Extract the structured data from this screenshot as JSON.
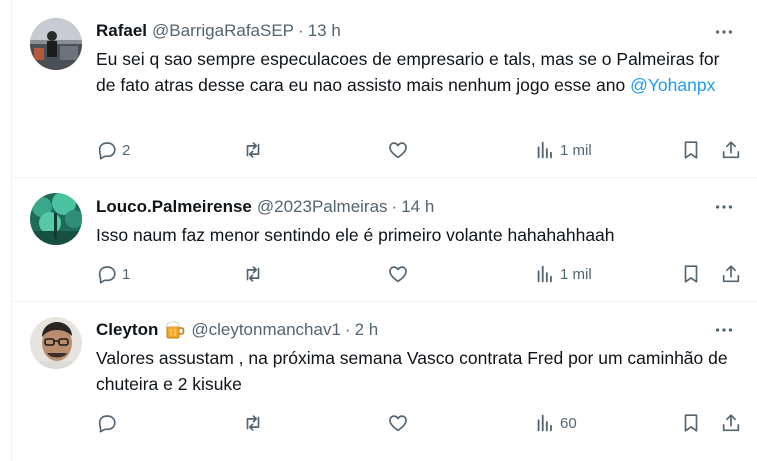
{
  "colors": {
    "accent": "#1d9bf0",
    "secondary_text": "#536471",
    "primary_text": "#0f1419",
    "divider": "#eff3f4"
  },
  "tweets": [
    {
      "name": "Rafael",
      "handle": "@BarrigaRafaSEP",
      "separator": "·",
      "time": "13 h",
      "text": "Eu sei q sao sempre especulacoes de empresario e tals, mas se o Palmeiras for de fato atras desse cara eu nao assisto mais nenhum jogo esse ano ",
      "mention": "@Yohanpx",
      "replies": "2",
      "retweets": "",
      "likes": "",
      "views": "1 mil"
    },
    {
      "name": "Louco.Palmeirense",
      "handle": "@2023Palmeiras",
      "separator": "·",
      "time": "14 h",
      "text": "Isso naum faz menor sentindo ele é primeiro volante hahahahhaah",
      "mention": "",
      "replies": "1",
      "retweets": "",
      "likes": "",
      "views": "1 mil"
    },
    {
      "name": "Cleyton",
      "badge_icon": "beer-mug-emoji-icon",
      "handle": "@cleytonmanchav1",
      "separator": "·",
      "time": "2 h",
      "text": "Valores assustam , na próxima semana Vasco contrata Fred por um caminhão de chuteira e 2 kisuke",
      "mention": "",
      "replies": "",
      "retweets": "",
      "likes": "",
      "views": "60"
    }
  ],
  "icons": [
    "more-icon",
    "reply-icon",
    "retweet-icon",
    "like-icon",
    "views-icon",
    "bookmark-icon",
    "share-icon"
  ]
}
